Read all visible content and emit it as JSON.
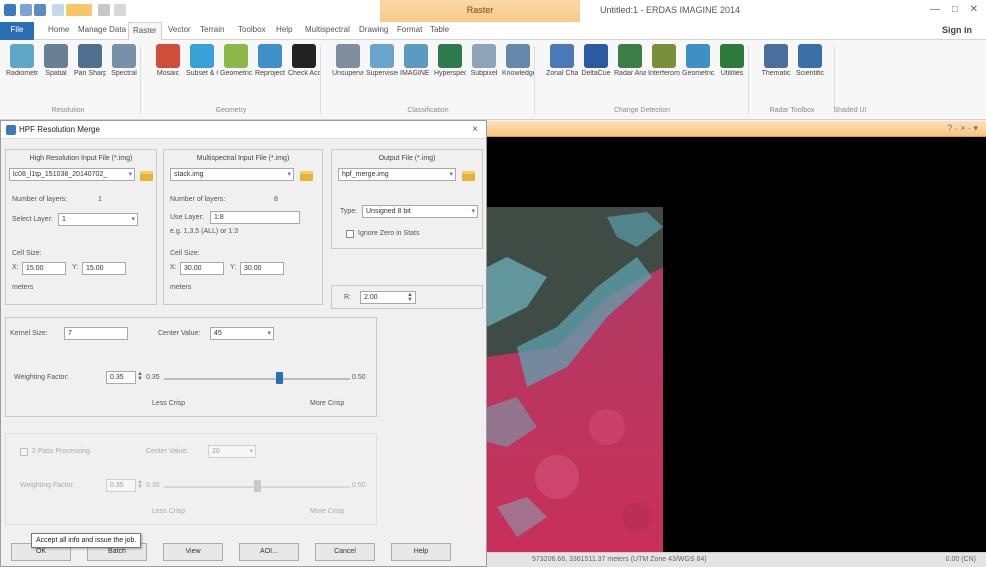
{
  "window": {
    "title": "Untitled:1 - ERDAS IMAGINE 2014",
    "contextual_tab": "Raster",
    "signin": "Sign in",
    "minimize": "—",
    "maximize": "□",
    "close": "✕"
  },
  "menu": {
    "tabs": [
      "File",
      "Home",
      "Manage Data",
      "Raster",
      "Vector",
      "Terrain",
      "Toolbox",
      "Help",
      "Multispectral",
      "Drawing",
      "Format",
      "Table"
    ],
    "active": "Raster"
  },
  "ribbon": {
    "buttons": [
      {
        "label": "Radiometric",
        "icon": "radiometric-icon",
        "color": "#5fa6c9"
      },
      {
        "label": "Spatial",
        "icon": "spatial-icon",
        "color": "#6a7f94"
      },
      {
        "label": "Pan Sharpen",
        "icon": "pan-sharpen-icon",
        "color": "#4f6f8f"
      },
      {
        "label": "Spectral",
        "icon": "spectral-icon",
        "color": "#7890a8"
      },
      {
        "label": "Mosaic",
        "icon": "mosaic-icon",
        "color": "#d04d3c"
      },
      {
        "label": "Subset & Chip",
        "icon": "subset-icon",
        "color": "#3aa0d8"
      },
      {
        "label": "Geometric Calibration",
        "icon": "geometric-calibration-icon",
        "color": "#8cb84a"
      },
      {
        "label": "Reproject",
        "icon": "reproject-icon",
        "color": "#3f8fc9"
      },
      {
        "label": "Check Accuracy",
        "icon": "check-accuracy-icon",
        "color": "#222222"
      },
      {
        "label": "Unsupervised",
        "icon": "unsupervised-icon",
        "color": "#7e8e9e"
      },
      {
        "label": "Supervised",
        "icon": "supervised-icon",
        "color": "#6aa4cf"
      },
      {
        "label": "IMAGINE Objective",
        "icon": "objective-icon",
        "color": "#5d9ac2"
      },
      {
        "label": "Hyperspectral",
        "icon": "hyperspectral-icon",
        "color": "#2e7a4e"
      },
      {
        "label": "Subpixel",
        "icon": "subpixel-icon",
        "color": "#8ea4b8"
      },
      {
        "label": "Knowledge Engineer",
        "icon": "knowledge-icon",
        "color": "#6688aa"
      },
      {
        "label": "Zonal Change",
        "icon": "zonal-change-icon",
        "color": "#4a78b8"
      },
      {
        "label": "DeltaCue",
        "icon": "deltacue-icon",
        "color": "#2c5aa0"
      },
      {
        "label": "Radar Analyst",
        "icon": "radar-icon",
        "color": "#3d7d4a"
      },
      {
        "label": "Interferometry",
        "icon": "interferometry-icon",
        "color": "#7a8f3a"
      },
      {
        "label": "Geometric Tools",
        "icon": "geometric-tools-icon",
        "color": "#3d8fc4"
      },
      {
        "label": "Utilities",
        "icon": "utilities-icon",
        "color": "#2e7a3a"
      },
      {
        "label": "Thematic",
        "icon": "thematic-icon",
        "color": "#4a6f9c"
      },
      {
        "label": "Scientific",
        "icon": "scientific-icon",
        "color": "#3a6fa8"
      }
    ],
    "groups": [
      "Resolution",
      "Geometry",
      "Classification",
      "Change Detection",
      "Radar Toolbox",
      "Shaded UI"
    ]
  },
  "dialog": {
    "title": "HPF Resolution Merge",
    "close": "×",
    "high_res": {
      "title": "High Resolution Input File (*.img)",
      "file": "lc08_l1tp_151038_20140702_",
      "layers_label": "Number of layers:",
      "layers_value": "1",
      "select_label": "Select Layer:",
      "select_value": "1",
      "cell_label": "Cell Size:",
      "x_label": "X:",
      "x_value": "15.00",
      "y_label": "Y:",
      "y_value": "15.00",
      "units": "meters"
    },
    "multi": {
      "title": "Multispectral Input File (*.img)",
      "file": "stack.img",
      "layers_label": "Number of layers:",
      "layers_value": "8",
      "layer_label": "Use Layer:",
      "layer_value": "1:8",
      "hint": "e.g. 1,3,5 (ALL) or 1:3",
      "cell_label": "Cell Size:",
      "x_label": "X:",
      "x_value": "30.00",
      "y_label": "Y:",
      "y_value": "30.00",
      "units": "meters"
    },
    "output": {
      "title": "Output File (*.img)",
      "file": "hpf_merge.img",
      "type_label": "Type:",
      "type_value": "Unsigned 8 bit",
      "ignore_label": "Ignore Zero in Stats",
      "r_label": "R:",
      "r_value": "2.00"
    },
    "kernel": {
      "size_label": "Kernel Size:",
      "size_value": "7",
      "center_label": "Center Value:",
      "center_value": "45",
      "weight_label": "Weighting Factor:",
      "weight_value": "0.35",
      "weight_min": "0.35",
      "weight_max": "0.50",
      "weight_level": 0.62,
      "less_label": "Less Crisp",
      "more_label": "More Crisp"
    },
    "two_pass": {
      "label": "2 Pass Processing",
      "center_label": "Center Value:",
      "center_value": "20",
      "weight_label": "Weighting Factor:",
      "weight_value": "0.35",
      "weight_min": "0.35",
      "weight_max": "0.50",
      "weight_level": 0.5,
      "less_label": "Less Crisp",
      "more_label": "More Crisp"
    },
    "buttons": {
      "ok": "OK",
      "batch": "Batch",
      "view": "View",
      "aoi": "AOI...",
      "cancel": "Cancel",
      "help": "Help"
    },
    "tooltip": "Accept all info and issue the job."
  },
  "viewer": {
    "header_controls": "? · × · ▾",
    "status": "573206.66, 3361511.37 meters (UTM Zone 43/WGS 84)",
    "status_right": "0.00 (CN)"
  }
}
